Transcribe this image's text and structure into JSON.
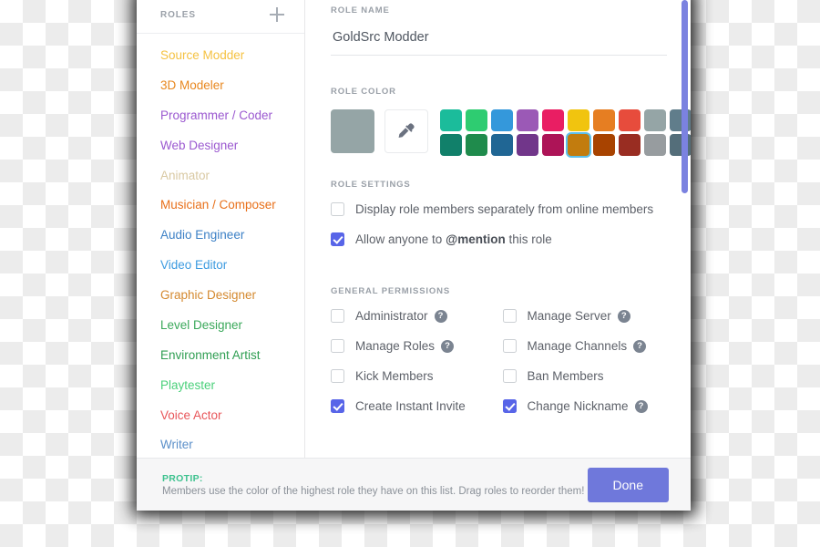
{
  "sidebar": {
    "title": "ROLES",
    "add_icon": "plus-icon",
    "items": [
      {
        "label": "Source Modder",
        "color": "#f5c242"
      },
      {
        "label": "3D Modeler",
        "color": "#e8871e"
      },
      {
        "label": "Programmer / Coder",
        "color": "#9b59d0"
      },
      {
        "label": "Web Designer",
        "color": "#9b59d0"
      },
      {
        "label": "Animator",
        "color": "#d9c9a3"
      },
      {
        "label": "Musician / Composer",
        "color": "#e8701a"
      },
      {
        "label": "Audio Engineer",
        "color": "#3d81c6"
      },
      {
        "label": "Video Editor",
        "color": "#3d9be0"
      },
      {
        "label": "Graphic Designer",
        "color": "#d4892f"
      },
      {
        "label": "Level Designer",
        "color": "#3aa85a"
      },
      {
        "label": "Environment Artist",
        "color": "#2f9e52"
      },
      {
        "label": "Playtester",
        "color": "#4ad07a"
      },
      {
        "label": "Voice Actor",
        "color": "#e8565a"
      },
      {
        "label": "Writer",
        "color": "#5b8fc9"
      }
    ]
  },
  "main": {
    "role_name": {
      "label": "ROLE NAME",
      "value": "GoldSrc Modder",
      "placeholder": "Role name"
    },
    "role_color": {
      "label": "ROLE COLOR",
      "current": "#95a5a6",
      "picker_icon": "eyedropper-icon",
      "selected_index": 15,
      "swatches": [
        "#1bbc9b",
        "#2ecc71",
        "#3498db",
        "#9b59b6",
        "#e91e63",
        "#f1c40f",
        "#e67e22",
        "#e74c3c",
        "#95a5a6",
        "#607d8b",
        "#11806a",
        "#1f8b4c",
        "#206694",
        "#71368a",
        "#ad1457",
        "#c27c0e",
        "#a84300",
        "#992d22",
        "#979c9f",
        "#546e7a"
      ]
    },
    "role_settings": {
      "label": "ROLE SETTINGS",
      "items": [
        {
          "label": "Display role members separately from online members",
          "checked": false,
          "help": false
        },
        {
          "label": "Allow anyone to @mention this role",
          "checked": true,
          "help": false,
          "bold_part": "@mention",
          "prefix": "Allow anyone to ",
          "suffix": " this role"
        }
      ]
    },
    "general_permissions": {
      "label": "GENERAL PERMISSIONS",
      "items": [
        {
          "label": "Administrator",
          "checked": false,
          "help": true
        },
        {
          "label": "Manage Server",
          "checked": false,
          "help": true
        },
        {
          "label": "Manage Roles",
          "checked": false,
          "help": true
        },
        {
          "label": "Manage Channels",
          "checked": false,
          "help": true
        },
        {
          "label": "Kick Members",
          "checked": false,
          "help": false
        },
        {
          "label": "Ban Members",
          "checked": false,
          "help": false
        },
        {
          "label": "Create Instant Invite",
          "checked": true,
          "help": false
        },
        {
          "label": "Change Nickname",
          "checked": true,
          "help": true
        }
      ]
    },
    "help_glyph": "?"
  },
  "footer": {
    "protip_title": "PROTIP:",
    "protip_text": "Members use the color of the highest role they have on this list. Drag roles to reorder them!",
    "done_label": "Done",
    "protip_accent": "#3ec28f",
    "done_color": "#6f78db"
  },
  "scrollbar": {
    "color": "#7b82e0"
  }
}
